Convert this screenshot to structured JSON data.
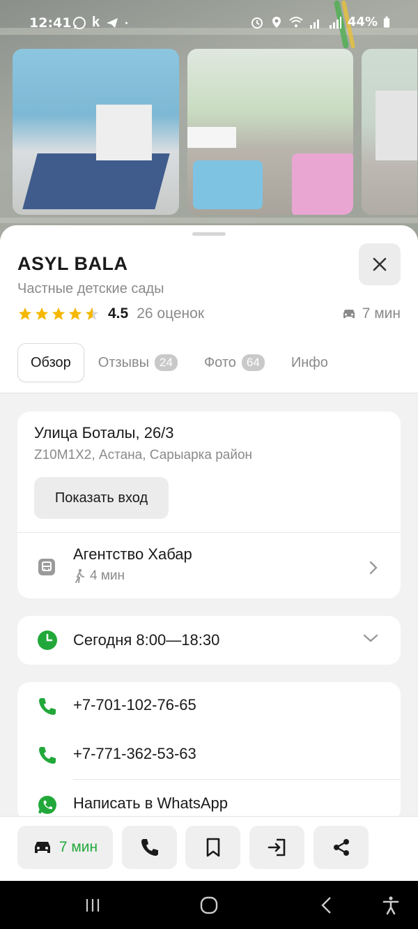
{
  "status_bar": {
    "time": "12:41",
    "k_icon": "k",
    "battery": "44%"
  },
  "place": {
    "name": "ASYL BALA",
    "category": "Частные детские сады",
    "rating": "4.5",
    "reviews_count": "26 оценок",
    "drive_time": "7 мин"
  },
  "tabs": [
    {
      "label": "Обзор",
      "active": true
    },
    {
      "label": "Отзывы",
      "badge": "24"
    },
    {
      "label": "Фото",
      "badge": "64"
    },
    {
      "label": "Инфо"
    }
  ],
  "address": {
    "street": "Улица Боталы, 26/3",
    "details": "Z10M1X2, Астана, Сарыарка район",
    "entrance_button": "Показать вход"
  },
  "transit": {
    "stop_name": "Агентство Хабар",
    "walk_time": "4 мин"
  },
  "hours": {
    "text": "Сегодня 8:00—18:30"
  },
  "contacts": {
    "phone1": "+7-701-102-76-65",
    "phone2": "+7-771-362-53-63",
    "whatsapp": "Написать в WhatsApp"
  },
  "actions": {
    "route_label": "7 мин"
  },
  "colors": {
    "accent_green": "#22a83a",
    "star_yellow": "#f5b700"
  }
}
